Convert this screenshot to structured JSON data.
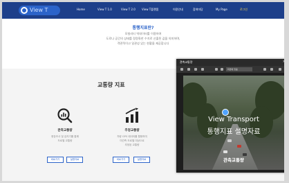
{
  "nav": {
    "logo_text": "View T",
    "items": [
      "Home",
      "View T 1.0",
      "View T 2.0",
      "View T플랫폼",
      "이용안내",
      "참여마당",
      "My Page",
      "로그인"
    ]
  },
  "hero": {
    "title": "통행지표란?",
    "lines": [
      "모빌리티 빅데이터를 이용하여",
      "도로나 공간의 상태를 정량화한 수치로 산출된 값을 의미하며,",
      "객관적이고 일관성 있는 현황을 제공합니다"
    ]
  },
  "section": {
    "title": "교통량 지표",
    "cards": [
      {
        "title": "관측교통량",
        "desc": [
          "현장조사 및 검지기를 통해",
          "도로별 교통량"
        ],
        "buttons": [
          "바로가기",
          "설명자료"
        ]
      },
      {
        "title": "추정교통량",
        "desc": [
          "차량 GPS 데이터를 활용하여",
          "미관측 도로별 대상으로",
          "추정된 교통량"
        ],
        "buttons": [
          "바로가기",
          "설명자료"
        ]
      }
    ]
  },
  "player": {
    "title": "관측교통량",
    "toolbar_select": "화면에 맞춤",
    "video_title": "View Transport",
    "video_subtitle": "통행지표 설명자료",
    "video_caption": "관측교통량"
  },
  "colors": {
    "nav_bg": "#1d3f8a",
    "accent": "#2b63c9",
    "active_nav": "#ffd84a"
  }
}
